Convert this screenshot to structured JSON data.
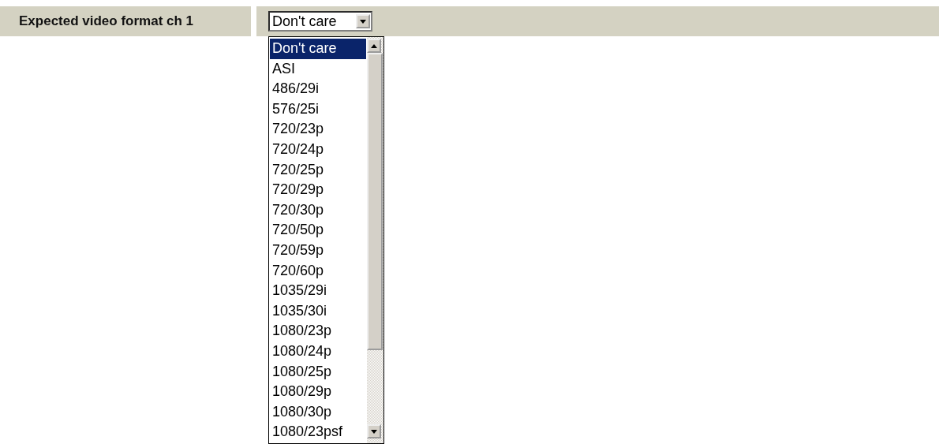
{
  "field": {
    "label": "Expected video format ch 1",
    "value": "Don't care",
    "open": true
  },
  "options": [
    {
      "label": "Don't care",
      "selected": true
    },
    {
      "label": "ASI",
      "selected": false
    },
    {
      "label": "486/29i",
      "selected": false
    },
    {
      "label": "576/25i",
      "selected": false
    },
    {
      "label": "720/23p",
      "selected": false
    },
    {
      "label": "720/24p",
      "selected": false
    },
    {
      "label": "720/25p",
      "selected": false
    },
    {
      "label": "720/29p",
      "selected": false
    },
    {
      "label": "720/30p",
      "selected": false
    },
    {
      "label": "720/50p",
      "selected": false
    },
    {
      "label": "720/59p",
      "selected": false
    },
    {
      "label": "720/60p",
      "selected": false
    },
    {
      "label": "1035/29i",
      "selected": false
    },
    {
      "label": "1035/30i",
      "selected": false
    },
    {
      "label": "1080/23p",
      "selected": false
    },
    {
      "label": "1080/24p",
      "selected": false
    },
    {
      "label": "1080/25p",
      "selected": false
    },
    {
      "label": "1080/29p",
      "selected": false
    },
    {
      "label": "1080/30p",
      "selected": false
    },
    {
      "label": "1080/23psf",
      "selected": false
    }
  ]
}
